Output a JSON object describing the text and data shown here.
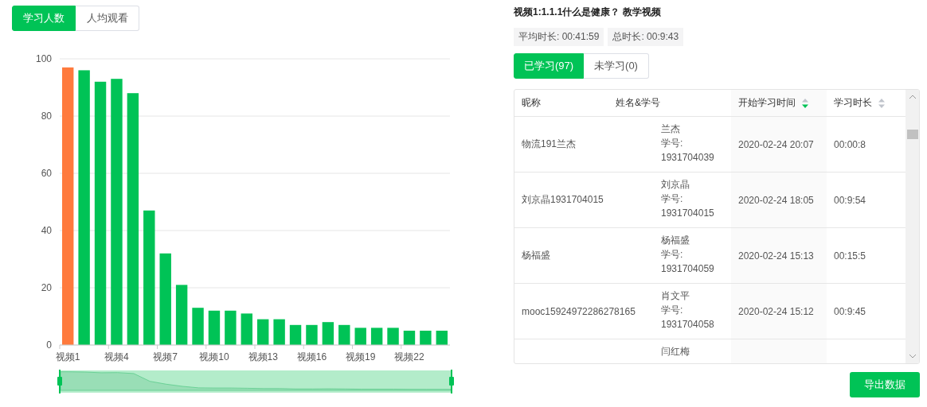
{
  "chart_tabs": [
    {
      "label": "学习人数",
      "selected": true
    },
    {
      "label": "人均观看",
      "selected": false
    }
  ],
  "chart": {
    "chart_data": {
      "type": "bar",
      "categories": [
        "视频1",
        null,
        null,
        "视频4",
        null,
        null,
        "视频7",
        null,
        null,
        "视频10",
        null,
        null,
        "视频13",
        null,
        null,
        "视频16",
        null,
        null,
        "视频19",
        null,
        null,
        "视频22",
        null,
        null
      ],
      "series": [
        {
          "color": "#ff7a3d",
          "values": [
            97,
            null,
            null,
            null,
            null,
            null,
            null,
            null,
            null,
            null,
            null,
            null,
            null,
            null,
            null,
            null,
            null,
            null,
            null,
            null,
            null,
            null,
            null,
            null
          ]
        },
        {
          "color": "#00c356",
          "values": [
            null,
            96,
            92,
            93,
            88,
            47,
            32,
            21,
            13,
            12,
            12,
            11,
            9,
            9,
            7,
            7,
            8,
            7,
            6,
            6,
            6,
            5,
            5,
            5
          ]
        }
      ],
      "ylim": [
        0,
        100
      ],
      "yticks": [
        0,
        20,
        40,
        60,
        80,
        100
      ],
      "grid": true
    }
  },
  "title": "视频1:1.1.1什么是健康？ 教学视频",
  "stats": [
    "平均时长: 00:41:59",
    "总时长: 00:9:43"
  ],
  "list_tabs": [
    {
      "label": "已学习(97)",
      "selected": true
    },
    {
      "label": "未学习(0)",
      "selected": false
    }
  ],
  "table": {
    "columns": [
      {
        "label": "昵称",
        "sortable": false
      },
      {
        "label": "姓名&学号",
        "sortable": false
      },
      {
        "label": "开始学习时间",
        "sortable": true,
        "sorted": true
      },
      {
        "label": "学习时长",
        "sortable": true,
        "sorted": false
      }
    ],
    "rows": [
      {
        "nickname": "物流191兰杰",
        "name": "兰杰",
        "id_label": "学号:",
        "id": "1931704039",
        "start": "2020-02-24 20:07",
        "duration": "00:00:8"
      },
      {
        "nickname": "刘京晶1931704015",
        "name": "刘京晶",
        "id_label": "学号:",
        "id": "1931704015",
        "start": "2020-02-24 18:05",
        "duration": "00:9:54"
      },
      {
        "nickname": "杨福盛",
        "name": "杨福盛",
        "id_label": "学号:",
        "id": "1931704059",
        "start": "2020-02-24 15:13",
        "duration": "00:15:5"
      },
      {
        "nickname": "mooc15924972286278165",
        "name": "肖文平",
        "id_label": "学号:",
        "id": "1931704058",
        "start": "2020-02-24 15:12",
        "duration": "00:9:45"
      },
      {
        "name": "闫红梅"
      }
    ]
  },
  "export_button": "导出数据"
}
